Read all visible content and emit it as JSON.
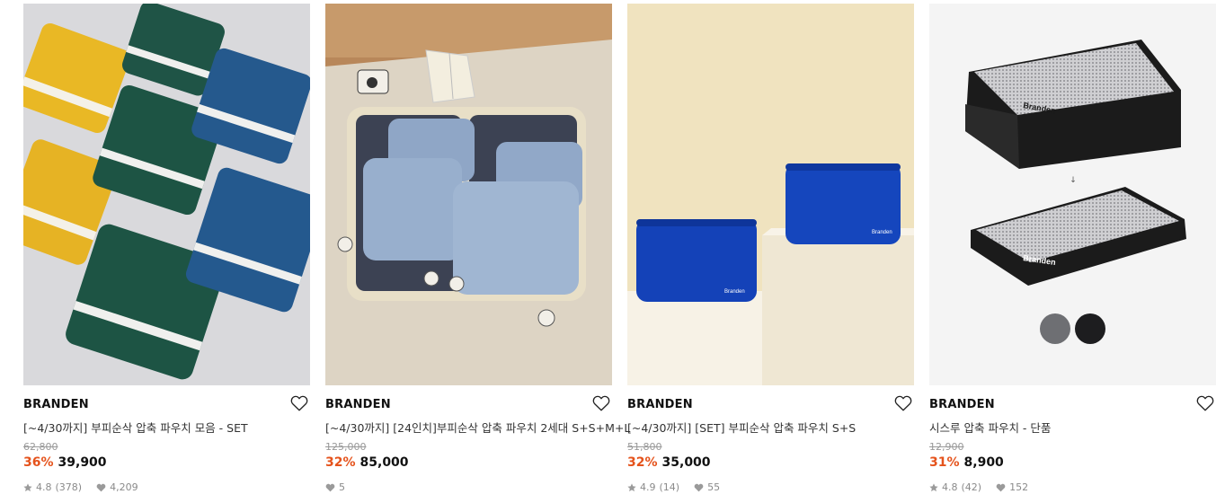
{
  "products": [
    {
      "brand": "BRANDEN",
      "name": "[~4/30까지] 부피순삭 압축 파우치 모음 - SET",
      "original_price": "62,800",
      "discount": "36%",
      "price": "39,900",
      "rating": "4.8",
      "reviews": "(378)",
      "likes": "4,209",
      "image_icon": "packing-pouch-set-photo"
    },
    {
      "brand": "BRANDEN",
      "name": "[~4/30까지] [24인치]부피순삭 압축 파우치 2세대 S+S+M+L",
      "original_price": "125,000",
      "discount": "32%",
      "price": "85,000",
      "likes": "5",
      "image_icon": "suitcase-pouch-photo"
    },
    {
      "brand": "BRANDEN",
      "name": "[~4/30까지] [SET] 부피순삭 압축 파우치 S+S",
      "original_price": "51,800",
      "discount": "32%",
      "price": "35,000",
      "rating": "4.9",
      "reviews": "(14)",
      "likes": "55",
      "image_icon": "blue-pouch-photo"
    },
    {
      "brand": "BRANDEN",
      "name": "시스루 압축 파우치 - 단품",
      "original_price": "12,900",
      "discount": "31%",
      "price": "8,900",
      "rating": "4.8",
      "reviews": "(42)",
      "likes": "152",
      "image_icon": "mesh-pouch-photo",
      "pouch_label": "Branden",
      "color_swatches": [
        "#6e6f73",
        "#1d1d1f"
      ]
    }
  ],
  "colors": {
    "discount": "#e5531c",
    "text": "#111111",
    "muted": "#8a8a8a"
  }
}
